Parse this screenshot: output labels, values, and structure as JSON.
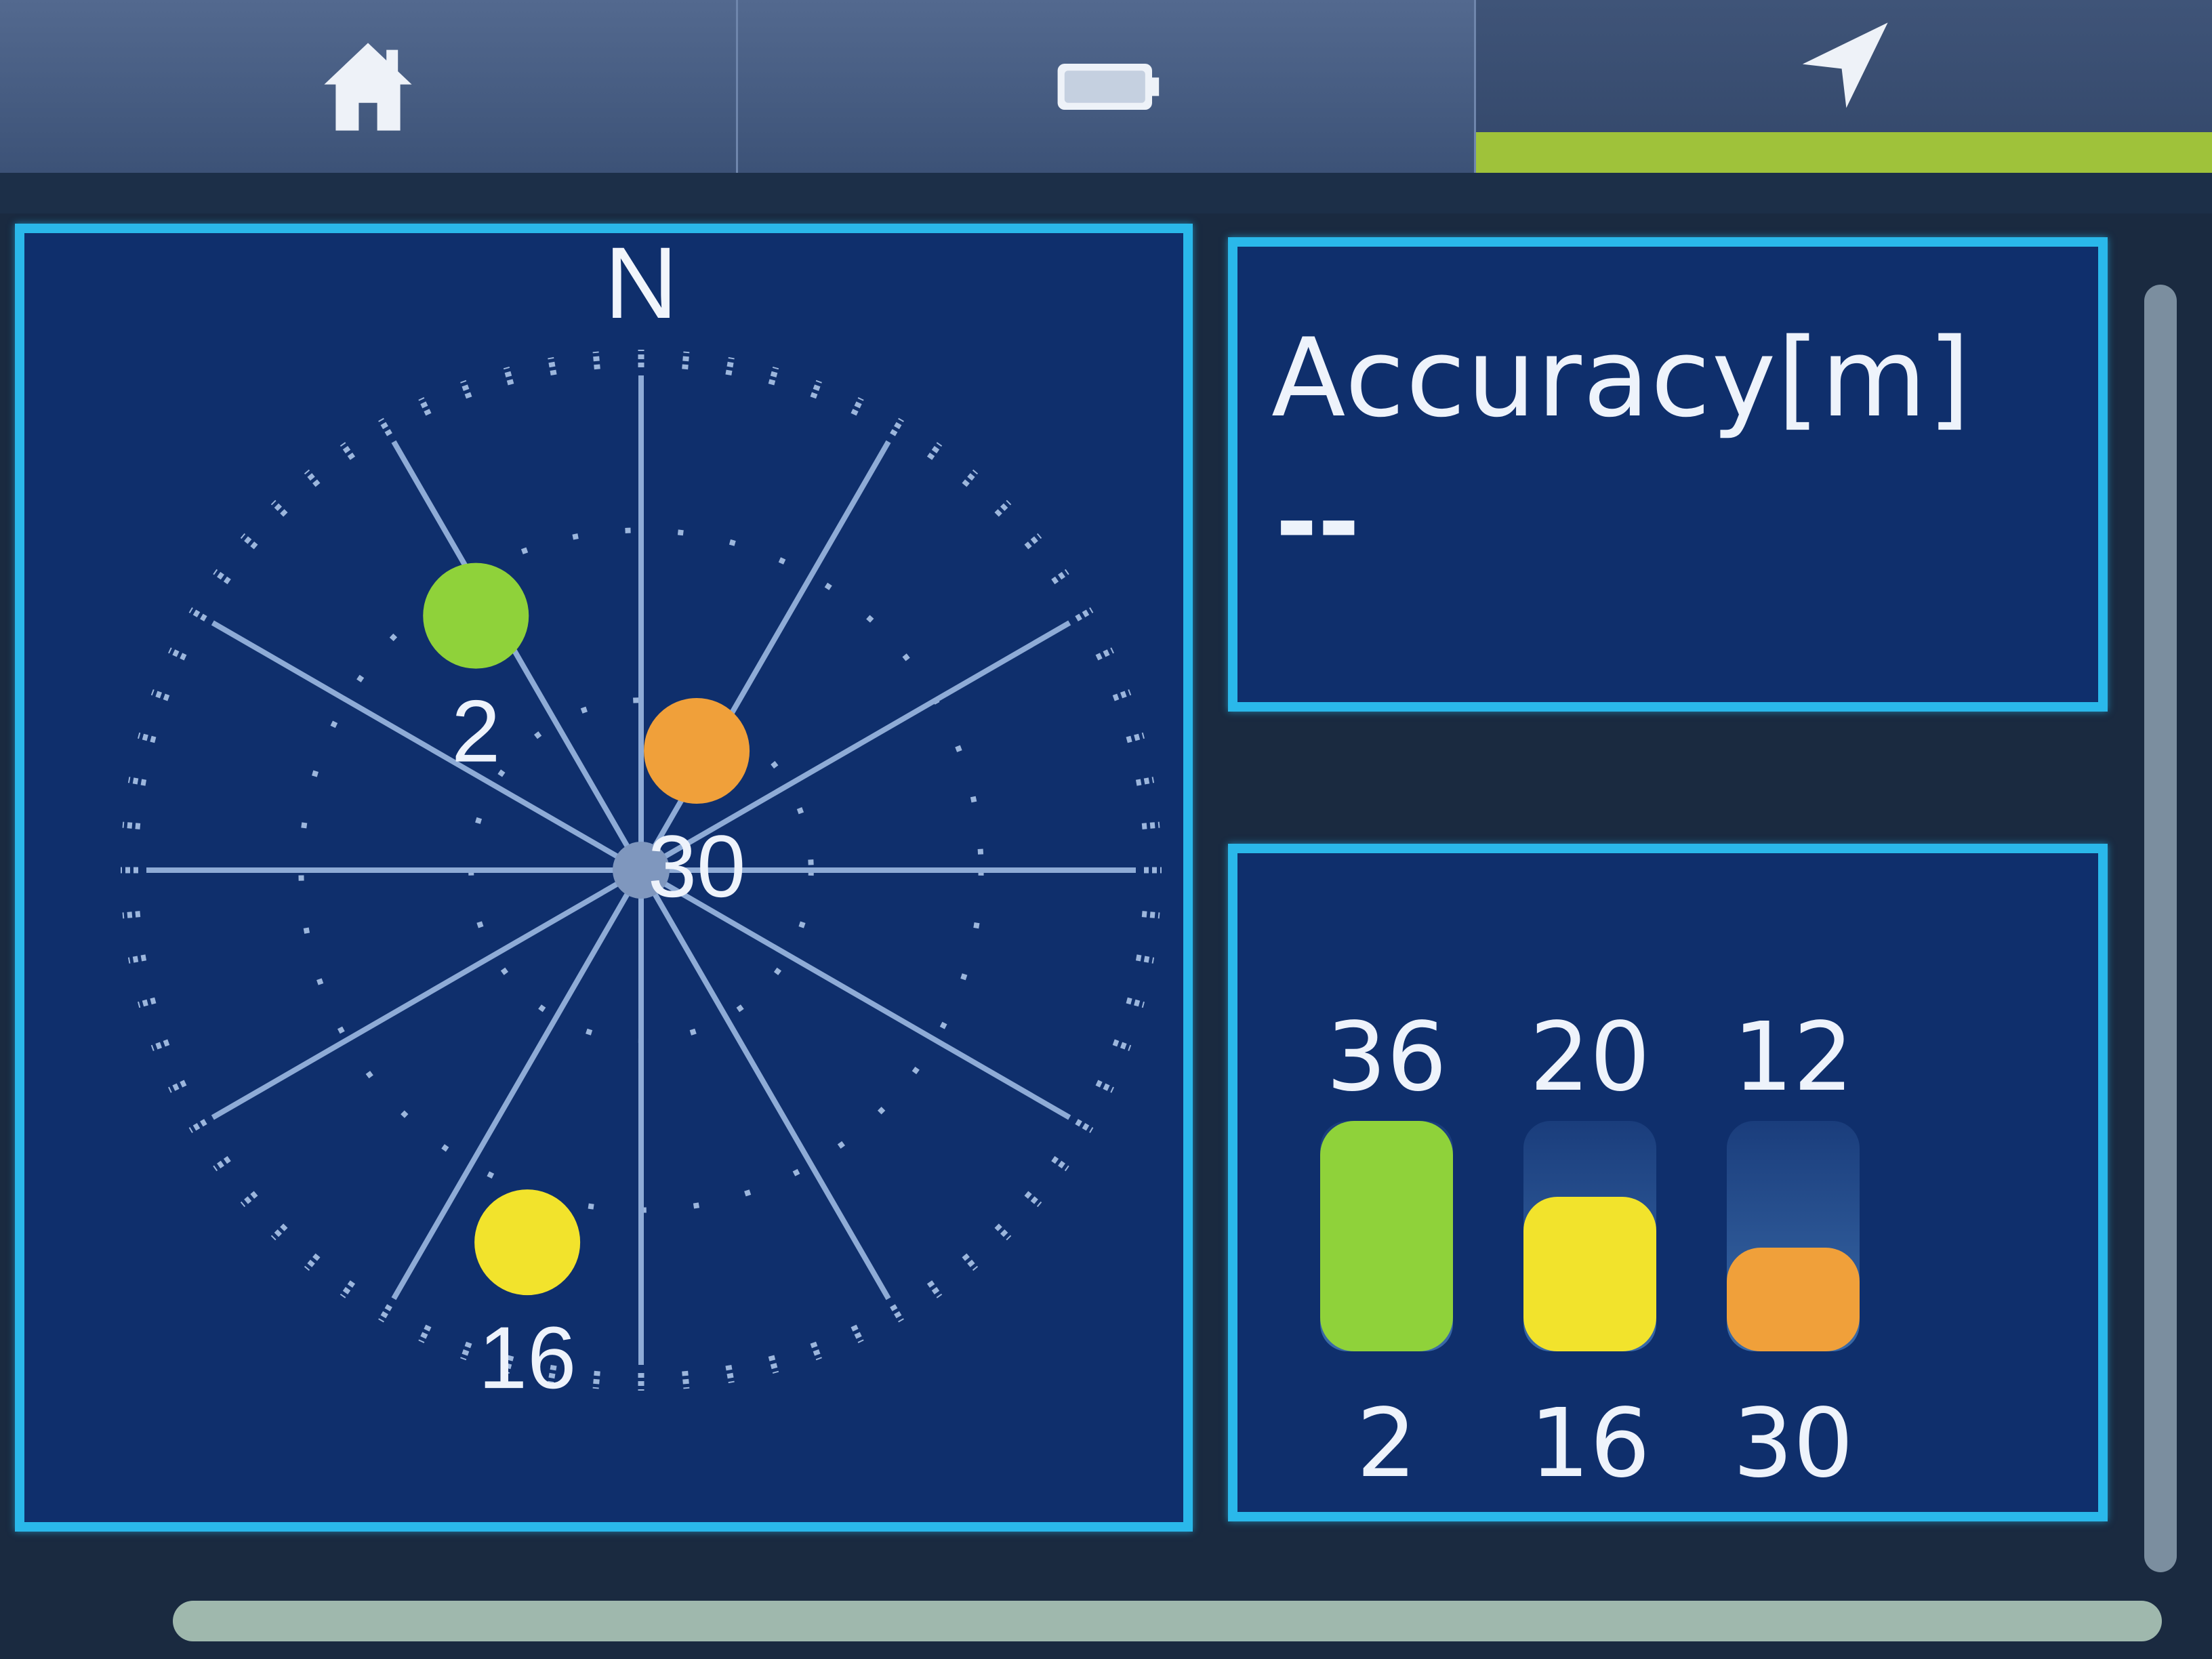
{
  "tabs": [
    {
      "id": "home",
      "icon": "home-icon",
      "active": false
    },
    {
      "id": "status",
      "icon": "battery-icon",
      "active": false
    },
    {
      "id": "gps",
      "icon": "navigation-arrow-icon",
      "active": true
    }
  ],
  "colors": {
    "panel_bg": "#0f2f6c",
    "panel_border": "#2ab8ea",
    "active_tab_bar": "#9fc23a",
    "sat_green": "#8fd23a",
    "sat_yellow": "#f2e32c",
    "sat_orange": "#f0a03a"
  },
  "skyplot": {
    "north_label": "N",
    "satellites": [
      {
        "id": "2",
        "azimuth_deg": 327,
        "elevation_deg": 37,
        "color": "#8fd23a"
      },
      {
        "id": "30",
        "azimuth_deg": 25,
        "elevation_deg": 67,
        "color": "#f0a03a"
      },
      {
        "id": "16",
        "azimuth_deg": 197,
        "elevation_deg": 22,
        "color": "#f2e32c"
      }
    ]
  },
  "accuracy": {
    "label": "Accuracy[m]",
    "value": "--"
  },
  "signal": {
    "satellites": [
      {
        "snr": "36",
        "id": "2",
        "level": 1.0,
        "color": "#8fd23a"
      },
      {
        "snr": "20",
        "id": "16",
        "level": 0.67,
        "color": "#f2e32c"
      },
      {
        "snr": "12",
        "id": "30",
        "level": 0.45,
        "color": "#f0a03a"
      }
    ]
  }
}
